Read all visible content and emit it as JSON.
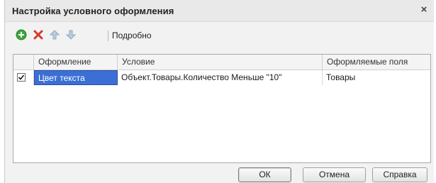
{
  "dialog": {
    "title": "Настройка условного оформления",
    "close_glyph": "×"
  },
  "toolbar": {
    "add_icon": "add-icon",
    "delete_icon": "delete-icon",
    "move_up_icon": "arrow-up-icon",
    "move_down_icon": "arrow-down-icon",
    "details_label": "Подробно"
  },
  "grid": {
    "columns": [
      "Оформление",
      "Условие",
      "Оформляемые поля"
    ],
    "rows": [
      {
        "checked": true,
        "appearance": "Цвет текста",
        "condition": "Объект.Товары.Количество Меньше \"10\"",
        "fields": "Товары"
      }
    ]
  },
  "buttons": {
    "ok": "ОК",
    "cancel": "Отмена",
    "help": "Справка"
  },
  "colors": {
    "selection": "#3b6fd6",
    "add_icon": "#3aa63a",
    "delete_icon": "#d33a2c",
    "arrows": "#9fb8cf"
  }
}
